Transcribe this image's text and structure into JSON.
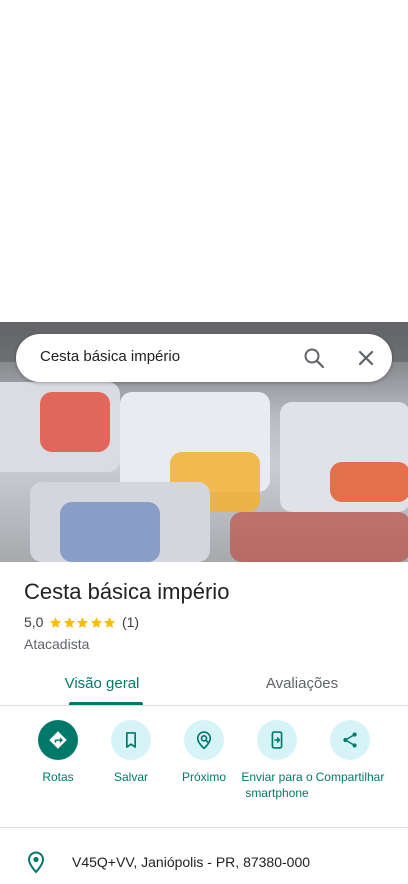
{
  "search": {
    "query": "Cesta básica império"
  },
  "place": {
    "title": "Cesta básica império",
    "rating": "5,0",
    "stars": 5,
    "review_count": "(1)",
    "category": "Atacadista"
  },
  "tabs": [
    {
      "label": "Visão geral",
      "active": true
    },
    {
      "label": "Avaliações",
      "active": false
    }
  ],
  "actions": [
    {
      "label": "Rotas",
      "icon": "directions-icon"
    },
    {
      "label": "Salvar",
      "icon": "bookmark-icon"
    },
    {
      "label": "Próximo",
      "icon": "nearby-icon"
    },
    {
      "label": "Enviar para o smartphone",
      "icon": "send-to-phone-icon"
    },
    {
      "label": "Compartilhar",
      "icon": "share-icon"
    }
  ],
  "address": {
    "text": "V45Q+VV, Janiópolis - PR, 87380-000"
  },
  "colors": {
    "accent": "#00796b",
    "action_bg": "#d6f3f8",
    "star": "#fbbc04"
  }
}
